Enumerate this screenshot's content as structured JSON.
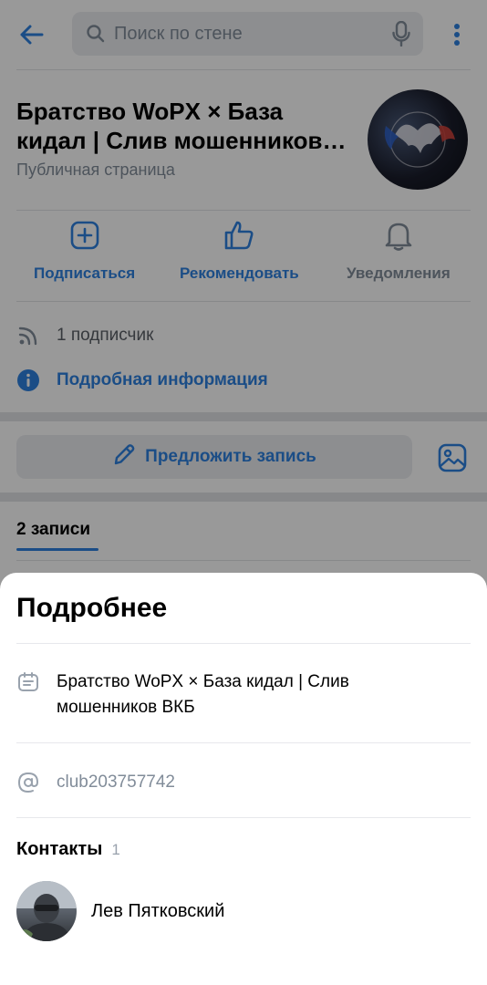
{
  "header": {
    "search_placeholder": "Поиск по стене"
  },
  "group": {
    "title": "Братство WoPX × База кидал | Слив мошенников…",
    "type": "Публичная страница"
  },
  "actions": [
    {
      "label": "Подписаться",
      "icon": "plus-square-icon"
    },
    {
      "label": "Рекомендовать",
      "icon": "thumbs-up-icon"
    },
    {
      "label": "Уведомления",
      "icon": "bell-icon"
    }
  ],
  "stats": {
    "subscribers": "1 подписчик",
    "details_link": "Подробная информация"
  },
  "suggest": {
    "label": "Предложить запись"
  },
  "tabs": {
    "posts": "2 записи"
  },
  "sheet": {
    "title": "Подробнее",
    "full_name": "Братство WoPX × База кидал | Слив мошенников ВКБ",
    "short_address": "club203757742",
    "contacts_title": "Контакты",
    "contacts_count": "1",
    "contact_name": "Лев Пятковский"
  },
  "colors": {
    "accent": "#2d81e0",
    "secondary_text": "#818c99",
    "background": "#ffffff"
  }
}
